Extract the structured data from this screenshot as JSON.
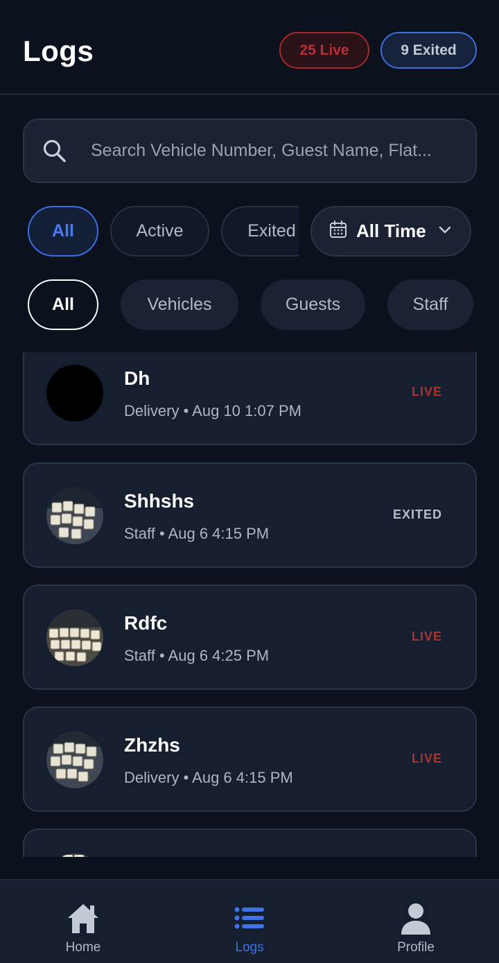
{
  "header": {
    "title": "Logs",
    "live_badge": "25 Live",
    "exited_badge": "9 Exited"
  },
  "search": {
    "placeholder": "Search Vehicle Number, Guest Name, Flat..."
  },
  "status_filters": {
    "all": "All",
    "active": "Active",
    "exited": "Exited",
    "selected": "All"
  },
  "time_filter": {
    "label": "All Time",
    "icon": "calendar-icon"
  },
  "type_filters": {
    "all": "All",
    "vehicles": "Vehicles",
    "guests": "Guests",
    "staff": "Staff",
    "selected": "All"
  },
  "logs": [
    {
      "name": "Dh",
      "meta": "Delivery • Aug 10 1:07 PM",
      "status": "LIVE",
      "avatar": "black"
    },
    {
      "name": "Shhshs",
      "meta": "Staff • Aug 6 4:15 PM",
      "status": "EXITED",
      "avatar": "photo"
    },
    {
      "name": "Rdfc",
      "meta": "Staff • Aug 6 4:25 PM",
      "status": "LIVE",
      "avatar": "photo"
    },
    {
      "name": "Zhzhs",
      "meta": "Delivery • Aug 6 4:15 PM",
      "status": "LIVE",
      "avatar": "photo"
    }
  ],
  "bottom_nav": {
    "home": "Home",
    "logs": "Logs",
    "profile": "Profile",
    "active": "Logs"
  },
  "colors": {
    "background": "#0b111d",
    "card": "#161f30",
    "accent_blue": "#3f74e6",
    "live_red": "#a7322f"
  }
}
